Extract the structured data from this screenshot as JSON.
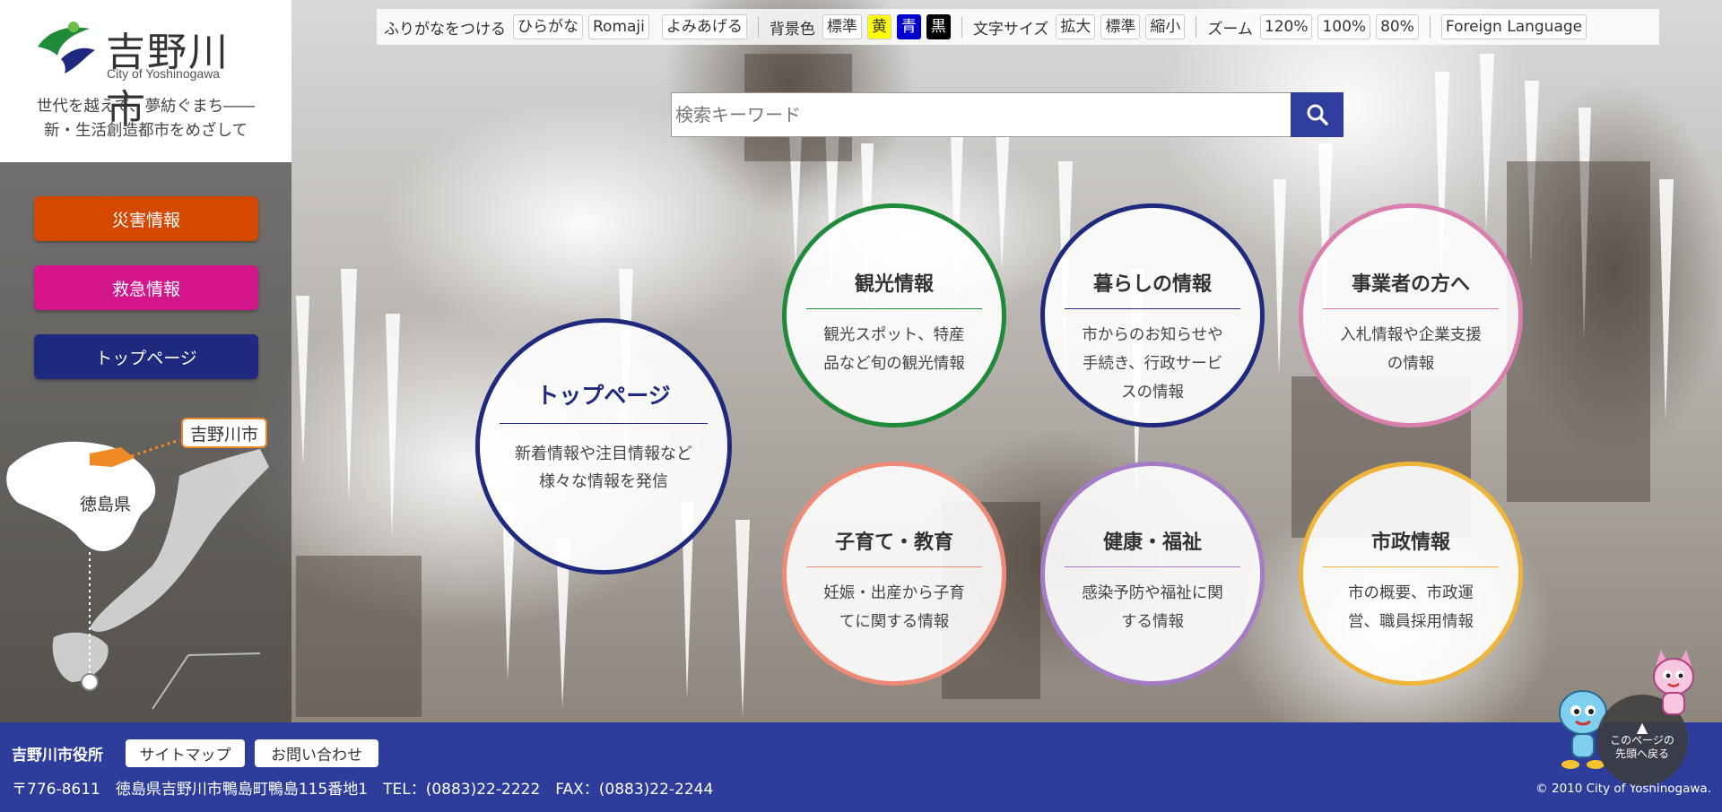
{
  "header": {
    "logo_name": "吉野川市",
    "logo_en": "City of Yoshinogawa",
    "slogan_line1": "世代を越えて、夢紡ぐまち――",
    "slogan_line2": "新・生活創造都市をめざして"
  },
  "toolbar": {
    "furigana_label": "ふりがなをつける",
    "hiragana": "ひらがな",
    "romaji": "Romaji",
    "read_aloud": "よみあげる",
    "bg_label": "背景色",
    "bg_standard": "標準",
    "bg_yellow": "黄",
    "bg_blue": "青",
    "bg_black": "黒",
    "font_label": "文字サイズ",
    "font_large": "拡大",
    "font_standard": "標準",
    "font_small": "縮小",
    "zoom_label": "ズーム",
    "zoom_120": "120%",
    "zoom_100": "100%",
    "zoom_80": "80%",
    "foreign": "Foreign Language"
  },
  "search": {
    "placeholder": "検索キーワード"
  },
  "side_buttons": {
    "disaster": "災害情報",
    "emergency": "救急情報",
    "top": "トップページ"
  },
  "map": {
    "city_tag": "吉野川市",
    "prefecture": "徳島県"
  },
  "circles": {
    "top": {
      "title": "トップページ",
      "desc1": "新着情報や注目情報など",
      "desc2": "様々な情報を発信"
    },
    "tourism": {
      "title": "観光情報",
      "desc1": "観光スポット、特産",
      "desc2": "品など旬の観光情報"
    },
    "living": {
      "title": "暮らしの情報",
      "desc1": "市からのお知らせや",
      "desc2": "手続き、行政サービ",
      "desc3": "スの情報"
    },
    "business": {
      "title": "事業者の方へ",
      "desc1": "入札情報や企業支援",
      "desc2": "の情報"
    },
    "childcare": {
      "title": "子育て・教育",
      "desc1": "妊娠・出産から子育",
      "desc2": "てに関する情報"
    },
    "health": {
      "title": "健康・福祉",
      "desc1": "感染予防や福祉に関",
      "desc2": "する情報"
    },
    "admin": {
      "title": "市政情報",
      "desc1": "市の概要、市政運",
      "desc2": "営、職員採用情報"
    }
  },
  "footer": {
    "office": "吉野川市役所",
    "sitemap": "サイトマップ",
    "contact": "お問い合わせ",
    "address": "〒776-8611　徳島県吉野川市鴨島町鴨島115番地1　TEL：(0883)22-2222　FAX：(0883)22-2244",
    "copyright": "© 2010 City of Yoshinogawa."
  },
  "back_to_top": {
    "line1": "このページの",
    "line2": "先頭へ戻る"
  },
  "colors": {
    "footer_bg": "#2e3d9c",
    "disaster": "#d44800",
    "emergency": "#d4168c",
    "top_nav": "#1f2a7e",
    "tourism_ring": "#1e8a3a",
    "living_ring": "#1f2a7e",
    "business_ring": "#d97fb0",
    "childcare_ring": "#ef8a78",
    "health_ring": "#a57bc6",
    "admin_ring": "#efb43a"
  }
}
